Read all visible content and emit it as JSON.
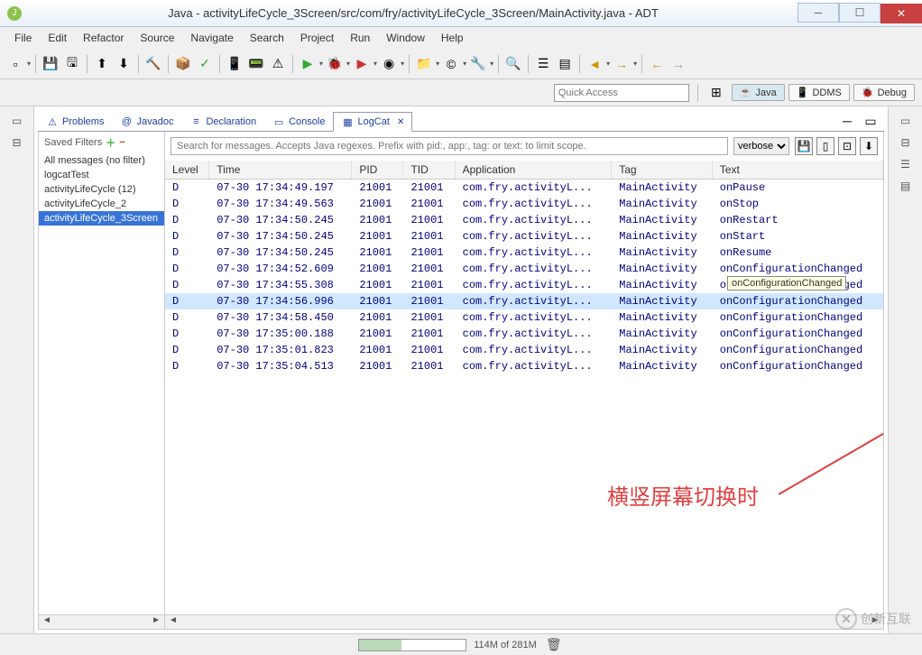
{
  "window": {
    "title": "Java - activityLifeCycle_3Screen/src/com/fry/activityLifeCycle_3Screen/MainActivity.java - ADT"
  },
  "menu": [
    "File",
    "Edit",
    "Refactor",
    "Source",
    "Navigate",
    "Search",
    "Project",
    "Run",
    "Window",
    "Help"
  ],
  "quickAccess": {
    "placeholder": "Quick Access"
  },
  "perspectives": [
    {
      "label": "Java",
      "active": true
    },
    {
      "label": "DDMS",
      "active": false
    },
    {
      "label": "Debug",
      "active": false
    }
  ],
  "tabs": [
    {
      "label": "Problems",
      "icon": "⚠"
    },
    {
      "label": "Javadoc",
      "icon": "@"
    },
    {
      "label": "Declaration",
      "icon": "≡"
    },
    {
      "label": "Console",
      "icon": "▭"
    },
    {
      "label": "LogCat",
      "icon": "▦",
      "active": true
    }
  ],
  "filters": {
    "header": "Saved Filters",
    "items": [
      "All messages (no filter)",
      "logcatTest",
      "activityLifeCycle (12)",
      "activityLifeCycle_2",
      "activityLifeCycle_3Screen"
    ],
    "selectedIndex": 4
  },
  "logcat": {
    "searchPlaceholder": "Search for messages. Accepts Java regexes. Prefix with pid:, app:, tag: or text: to limit scope.",
    "verbosity": "verbose",
    "columns": [
      "Level",
      "Time",
      "PID",
      "TID",
      "Application",
      "Tag",
      "Text"
    ],
    "rows": [
      {
        "level": "D",
        "time": "07-30 17:34:49.197",
        "pid": "21001",
        "tid": "21001",
        "app": "com.fry.activityL...",
        "tag": "MainActivity",
        "text": "onPause"
      },
      {
        "level": "D",
        "time": "07-30 17:34:49.563",
        "pid": "21001",
        "tid": "21001",
        "app": "com.fry.activityL...",
        "tag": "MainActivity",
        "text": "onStop"
      },
      {
        "level": "D",
        "time": "07-30 17:34:50.245",
        "pid": "21001",
        "tid": "21001",
        "app": "com.fry.activityL...",
        "tag": "MainActivity",
        "text": "onRestart"
      },
      {
        "level": "D",
        "time": "07-30 17:34:50.245",
        "pid": "21001",
        "tid": "21001",
        "app": "com.fry.activityL...",
        "tag": "MainActivity",
        "text": "onStart"
      },
      {
        "level": "D",
        "time": "07-30 17:34:50.245",
        "pid": "21001",
        "tid": "21001",
        "app": "com.fry.activityL...",
        "tag": "MainActivity",
        "text": "onResume"
      },
      {
        "level": "D",
        "time": "07-30 17:34:52.609",
        "pid": "21001",
        "tid": "21001",
        "app": "com.fry.activityL...",
        "tag": "MainActivity",
        "text": "onConfigurationChanged"
      },
      {
        "level": "D",
        "time": "07-30 17:34:55.308",
        "pid": "21001",
        "tid": "21001",
        "app": "com.fry.activityL...",
        "tag": "MainActivity",
        "text": "onConfigurationChanged"
      },
      {
        "level": "D",
        "time": "07-30 17:34:56.996",
        "pid": "21001",
        "tid": "21001",
        "app": "com.fry.activityL...",
        "tag": "MainActivity",
        "text": "onConfigurationChanged",
        "selected": true
      },
      {
        "level": "D",
        "time": "07-30 17:34:58.450",
        "pid": "21001",
        "tid": "21001",
        "app": "com.fry.activityL...",
        "tag": "MainActivity",
        "text": "onConfigurationChanged"
      },
      {
        "level": "D",
        "time": "07-30 17:35:00.188",
        "pid": "21001",
        "tid": "21001",
        "app": "com.fry.activityL...",
        "tag": "MainActivity",
        "text": "onConfigurationChanged"
      },
      {
        "level": "D",
        "time": "07-30 17:35:01.823",
        "pid": "21001",
        "tid": "21001",
        "app": "com.fry.activityL...",
        "tag": "MainActivity",
        "text": "onConfigurationChanged"
      },
      {
        "level": "D",
        "time": "07-30 17:35:04.513",
        "pid": "21001",
        "tid": "21001",
        "app": "com.fry.activityL...",
        "tag": "MainActivity",
        "text": "onConfigurationChanged"
      }
    ],
    "tooltip": "onConfigurationChanged"
  },
  "annotation": {
    "text": "横竖屏幕切换时"
  },
  "status": {
    "memory": "114M of 281M"
  },
  "watermark": "创新互联"
}
